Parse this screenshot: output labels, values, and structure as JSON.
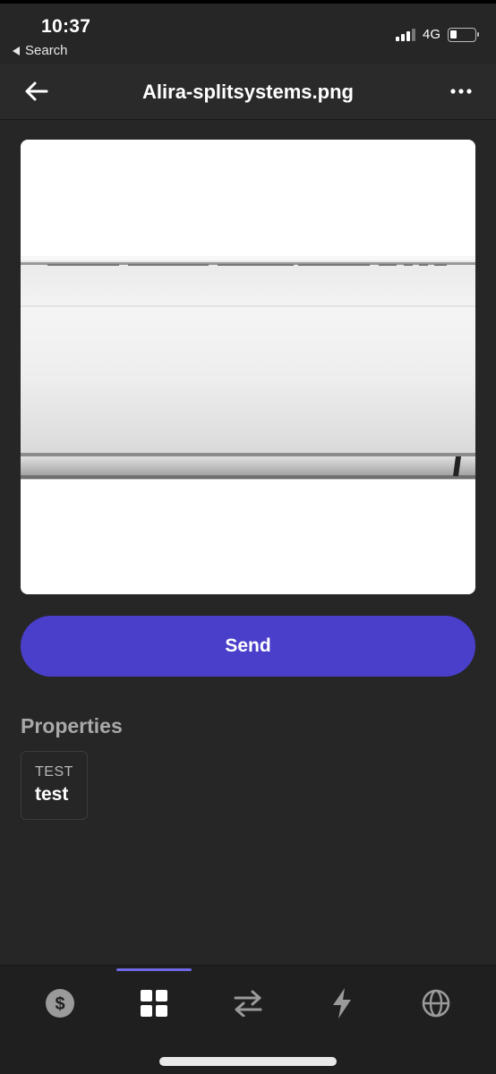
{
  "status_bar": {
    "time": "10:37",
    "back_app": "Search",
    "network": "4G"
  },
  "nav": {
    "title": "Alira-splitsystems.png",
    "back_icon": "arrow-left-icon",
    "more_icon": "more-horizontal-icon"
  },
  "image": {
    "subject": "split-system-air-conditioner-icon"
  },
  "actions": {
    "send_label": "Send",
    "accent_color": "#4a3fcb"
  },
  "properties": {
    "title": "Properties",
    "items": [
      {
        "key": "TEST",
        "value": "test"
      }
    ]
  },
  "tabs": [
    {
      "icon": "dollar-icon",
      "active": false
    },
    {
      "icon": "grid-icon",
      "active": true
    },
    {
      "icon": "transfer-arrows-icon",
      "active": false
    },
    {
      "icon": "lightning-icon",
      "active": false
    },
    {
      "icon": "globe-icon",
      "active": false
    }
  ]
}
